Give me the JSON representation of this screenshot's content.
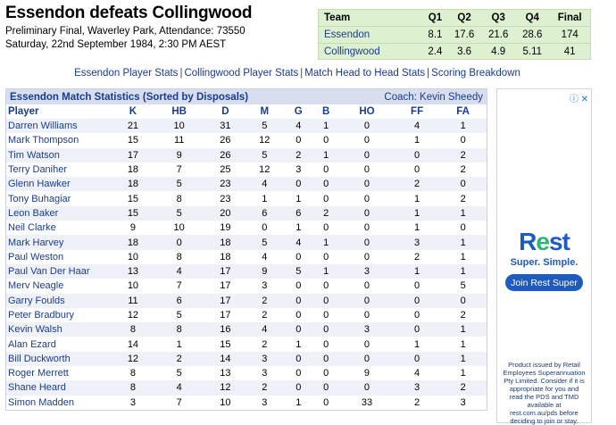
{
  "header": {
    "title": "Essendon defeats Collingwood",
    "match_info": "Preliminary Final, Waverley Park, Attendance: 73550",
    "date_time": "Saturday, 22nd September 1984, 2:30 PM AEST"
  },
  "scoreboard": {
    "columns": [
      "Team",
      "Q1",
      "Q2",
      "Q3",
      "Q4",
      "Final"
    ],
    "rows": [
      {
        "team": "Essendon",
        "q1": "8.1",
        "q2": "17.6",
        "q3": "21.6",
        "q4": "28.6",
        "final": "174"
      },
      {
        "team": "Collingwood",
        "q1": "2.4",
        "q2": "3.6",
        "q3": "4.9",
        "q4": "5.11",
        "final": "41"
      }
    ]
  },
  "nav_links": [
    "Essendon Player Stats",
    "Collingwood Player Stats",
    "Match Head to Head Stats",
    "Scoring Breakdown"
  ],
  "stats": {
    "title": "Essendon Match Statistics (Sorted by Disposals)",
    "coach": "Coach: Kevin Sheedy",
    "columns": [
      "Player",
      "K",
      "HB",
      "D",
      "M",
      "G",
      "B",
      "HO",
      "FF",
      "FA"
    ],
    "rows": [
      [
        "Darren Williams",
        "21",
        "10",
        "31",
        "5",
        "4",
        "1",
        "0",
        "4",
        "1"
      ],
      [
        "Mark Thompson",
        "15",
        "11",
        "26",
        "12",
        "0",
        "0",
        "0",
        "1",
        "0"
      ],
      [
        "Tim Watson",
        "17",
        "9",
        "26",
        "5",
        "2",
        "1",
        "0",
        "0",
        "2"
      ],
      [
        "Terry Daniher",
        "18",
        "7",
        "25",
        "12",
        "3",
        "0",
        "0",
        "0",
        "2"
      ],
      [
        "Glenn Hawker",
        "18",
        "5",
        "23",
        "4",
        "0",
        "0",
        "0",
        "2",
        "0"
      ],
      [
        "Tony Buhagiar",
        "15",
        "8",
        "23",
        "1",
        "1",
        "0",
        "0",
        "1",
        "2"
      ],
      [
        "Leon Baker",
        "15",
        "5",
        "20",
        "6",
        "6",
        "2",
        "0",
        "1",
        "1"
      ],
      [
        "Neil Clarke",
        "9",
        "10",
        "19",
        "0",
        "1",
        "0",
        "0",
        "1",
        "0"
      ],
      [
        "Mark Harvey",
        "18",
        "0",
        "18",
        "5",
        "4",
        "1",
        "0",
        "3",
        "1"
      ],
      [
        "Paul Weston",
        "10",
        "8",
        "18",
        "4",
        "0",
        "0",
        "0",
        "2",
        "1"
      ],
      [
        "Paul Van Der Haar",
        "13",
        "4",
        "17",
        "9",
        "5",
        "1",
        "3",
        "1",
        "1"
      ],
      [
        "Merv Neagle",
        "10",
        "7",
        "17",
        "3",
        "0",
        "0",
        "0",
        "0",
        "5"
      ],
      [
        "Garry Foulds",
        "11",
        "6",
        "17",
        "2",
        "0",
        "0",
        "0",
        "0",
        "0"
      ],
      [
        "Peter Bradbury",
        "12",
        "5",
        "17",
        "2",
        "0",
        "0",
        "0",
        "0",
        "2"
      ],
      [
        "Kevin Walsh",
        "8",
        "8",
        "16",
        "4",
        "0",
        "0",
        "3",
        "0",
        "1"
      ],
      [
        "Alan Ezard",
        "14",
        "1",
        "15",
        "2",
        "1",
        "0",
        "0",
        "1",
        "1"
      ],
      [
        "Bill Duckworth",
        "12",
        "2",
        "14",
        "3",
        "0",
        "0",
        "0",
        "0",
        "1"
      ],
      [
        "Roger Merrett",
        "8",
        "5",
        "13",
        "3",
        "0",
        "0",
        "9",
        "4",
        "1"
      ],
      [
        "Shane Heard",
        "8",
        "4",
        "12",
        "2",
        "0",
        "0",
        "0",
        "3",
        "2"
      ],
      [
        "Simon Madden",
        "3",
        "7",
        "10",
        "3",
        "1",
        "0",
        "33",
        "2",
        "3"
      ]
    ]
  },
  "ad": {
    "choices_icon": "ad-choices-icon",
    "close_icon": "close-icon",
    "brand_prefix": "R",
    "brand_accent": "e",
    "brand_suffix": "st",
    "tagline": "Super. Simple.",
    "cta_label": "Join Rest Super",
    "fine_print": "Product issued by Retail Employees Superannuation Pty Limited. Consider if it is appropriate for you and read the PDS and TMD available at rest.com.au/pds before deciding to join or stay.",
    "colors": {
      "brand": "#1d5bbf",
      "accent": "#2bb673"
    }
  },
  "colors": {
    "link": "#1a3c8c",
    "score_bg": "#ddf0d0",
    "stats_header_bg": "#d7deee",
    "stripe": "#eef1f7"
  }
}
